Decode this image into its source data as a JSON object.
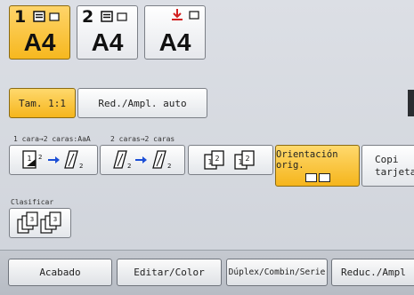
{
  "trays": [
    {
      "number": "1",
      "size": "A4"
    },
    {
      "number": "2",
      "size": "A4"
    },
    {
      "size": "A4"
    }
  ],
  "reduce_enlarge": {
    "full_size": "Tam. 1:1",
    "auto": "Red./Ampl. auto"
  },
  "duplex_section": {
    "label_1": "1 cara→2 caras:AaA",
    "label_2": "2 caras→2 caras",
    "orientation_label": "Orientación orig.",
    "id_card_label_line1": "Copi",
    "id_card_label_line2": "tarjeta"
  },
  "sort_section": {
    "label": "Clasificar"
  },
  "tabs": {
    "finishing": "Acabado",
    "edit_color": "Editar/Color",
    "duplex": "Dúplex/Combin/Serie",
    "reduce": "Reduc./Ampl"
  },
  "colors": {
    "selected": "#f6b81f",
    "bypass_arrow": "#d22020"
  }
}
